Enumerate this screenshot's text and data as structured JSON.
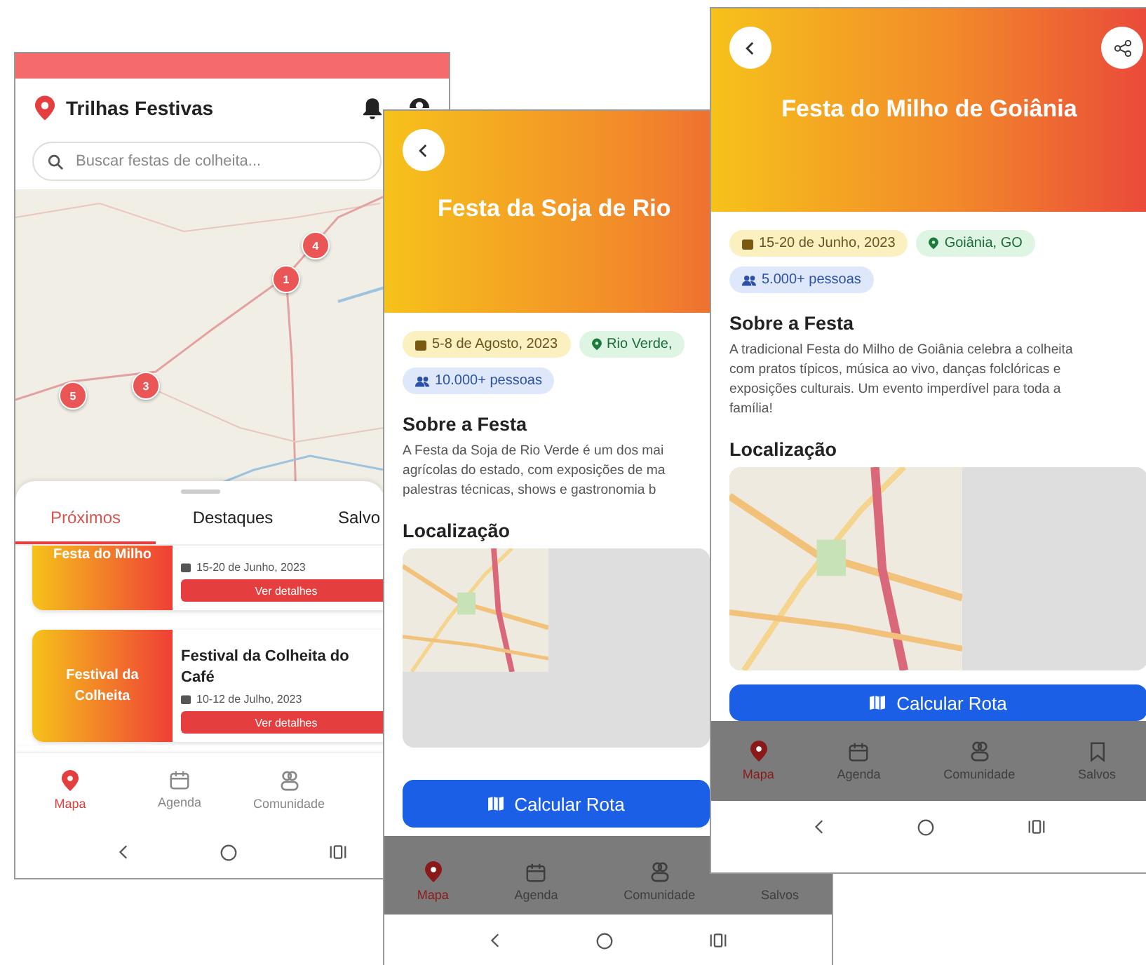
{
  "screens": [
    {
      "kind": "home",
      "app_title": "Trilhas Festivas",
      "search": {
        "placeholder": "Buscar festas de colheita..."
      },
      "map_markers": [
        {
          "label": "4"
        },
        {
          "label": "1"
        },
        {
          "label": "3"
        },
        {
          "label": "5"
        }
      ],
      "tabs": [
        {
          "label": "Próximos",
          "selected": true
        },
        {
          "label": "Destaques",
          "selected": false
        },
        {
          "label": "Salvo",
          "selected": false
        }
      ],
      "cards": [
        {
          "banner": "Festa do Milho",
          "date": "15-20 de Junho, 2023",
          "button": "Ver detalhes"
        },
        {
          "banner": "Festival da Colheita",
          "title": "Festival da Colheita do Café",
          "date": "10-12 de Julho, 2023",
          "button": "Ver detalhes"
        }
      ],
      "nav_dimmed": false,
      "nav": [
        {
          "kind": "pin",
          "label": "Mapa",
          "selected": true
        },
        {
          "kind": "calendar",
          "label": "Agenda",
          "selected": false
        },
        {
          "kind": "people",
          "label": "Comunidade",
          "selected": false
        }
      ]
    },
    {
      "kind": "detail",
      "title": "Festa da Soja de Rio",
      "chips": [
        {
          "kind": "date",
          "text": "5-8 de Agosto, 2023"
        },
        {
          "kind": "place",
          "text": "Rio Verde,"
        },
        {
          "kind": "people",
          "text": "10.000+ pessoas"
        }
      ],
      "about_heading": "Sobre a Festa",
      "about_lines": [
        "A Festa da Soja de Rio Verde é um dos mai",
        "agrícolas do estado, com exposições de ma",
        "palestras técnicas, shows e gastronomia b"
      ],
      "map_heading": "Localização",
      "route_button": "Calcular Rota",
      "nav_dimmed": true,
      "nav": [
        {
          "kind": "pin",
          "label": "Mapa",
          "selected": true
        },
        {
          "kind": "calendar",
          "label": "Agenda",
          "selected": false
        },
        {
          "kind": "people",
          "label": "Comunidade",
          "selected": false
        },
        {
          "kind": "bookmark",
          "label": "Salvos",
          "selected": false
        }
      ]
    },
    {
      "kind": "detail",
      "title": "Festa do Milho de Goiânia",
      "share_button": true,
      "chips": [
        {
          "kind": "date",
          "text": "15-20 de Junho, 2023"
        },
        {
          "kind": "place",
          "text": "Goiânia, GO"
        },
        {
          "kind": "people",
          "text": "5.000+ pessoas"
        }
      ],
      "about_heading": "Sobre a Festa",
      "about_lines": [
        "A tradicional Festa do Milho de Goiânia celebra a colheita",
        "com pratos típicos, música ao vivo, danças folclóricas e",
        "exposições culturais. Um evento imperdível para toda a",
        "família!"
      ],
      "map_heading": "Localização",
      "route_button": "Calcular Rota",
      "nav_dimmed": true,
      "nav": [
        {
          "kind": "pin",
          "label": "Mapa",
          "selected": true
        },
        {
          "kind": "calendar",
          "label": "Agenda",
          "selected": false
        },
        {
          "kind": "people",
          "label": "Comunidade",
          "selected": false
        },
        {
          "kind": "bookmark",
          "label": "Salvos",
          "selected": false
        }
      ]
    }
  ]
}
